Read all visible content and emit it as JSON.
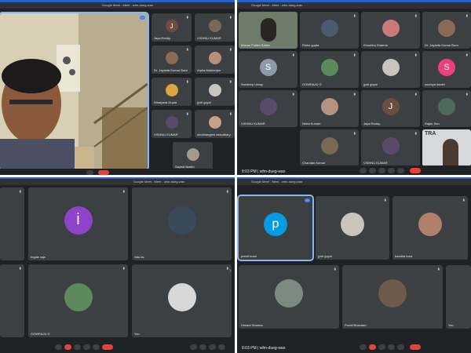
{
  "meet": {
    "window_title": "Google Meet - Meet - wfm-dueg-wan",
    "time": "8:03 PM",
    "code": "wfm-dueg-wan"
  },
  "q1": {
    "participants": [
      "Jaya Reddy",
      "VISHNU KUMAR",
      "Dr. Jayanta Kumar Bora",
      "Arpita Mukherjee",
      "Niharjana Gupta",
      "jyoti goyal",
      "VISHNU KUMAR",
      "shubhangeni chaudhary",
      "Sayedi Nasim"
    ]
  },
  "q2": {
    "participants": [
      "Manas Pratim Saikia",
      "Rinku gupta",
      "Khushbu Sharma",
      "Dr. Jayanta Kumar Bora",
      "Sandeep Umap",
      "GOWRAJU G",
      "jyoti goyal",
      "soumya daniel",
      "VISHNU KUMAR",
      "Neha Kumari",
      "Jaya Reddy",
      "Rajan Sen",
      "Chandan Kumar",
      "VISHNU KUMAR",
      ""
    ],
    "avatar_letters": {
      "sandeep": "S",
      "jaya": "J",
      "soumya": "S"
    },
    "tra_label": "TRA"
  },
  "q3": {
    "participants": [
      "",
      "Ingale raja",
      "vidu ks",
      "",
      "GOWRAJU G",
      "You"
    ],
    "avatar_letters": {
      "ingale": "i"
    }
  },
  "q4": {
    "participants": [
      "preeti bose",
      "jyoti goyal",
      "bandita bora",
      "Himani Sharma",
      "Preeti Bhandari",
      "You"
    ],
    "avatar_letters": {
      "preeti": "p"
    }
  },
  "icons": {
    "mic": "mic-off-icon",
    "end": "end-call-icon",
    "more": "more-icon"
  },
  "colors": {
    "accent": "#8ab4f8",
    "end": "#ea4335",
    "tile": "#3c4043",
    "bg": "#202124",
    "blue_bar": "#2b61c9"
  }
}
